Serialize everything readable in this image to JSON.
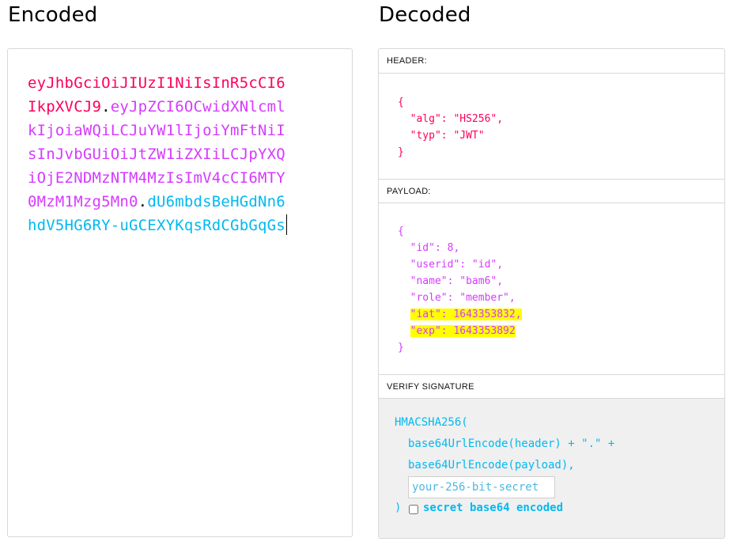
{
  "encoded": {
    "title": "Encoded",
    "token_lines": [
      [
        {
          "t": "eyJhbGciOiJIUzI1NiIsInR5cCI6",
          "c": "seg-header"
        }
      ],
      [
        {
          "t": "IkpXVCJ9",
          "c": "seg-header"
        },
        {
          "t": ".",
          "c": "dot"
        },
        {
          "t": "eyJpZCI6OCwidXNlcml",
          "c": "seg-payload"
        }
      ],
      [
        {
          "t": "kIjoiaWQiLCJuYW1lIjoiYmFtNiI",
          "c": "seg-payload"
        }
      ],
      [
        {
          "t": "sInJvbGUiOiJtZW1iZXIiLCJpYXQ",
          "c": "seg-payload"
        }
      ],
      [
        {
          "t": "iOjE2NDMzNTM4MzIsImV4cCI6MTY",
          "c": "seg-payload"
        }
      ],
      [
        {
          "t": "0MzM1Mzg5Mn0",
          "c": "seg-payload"
        },
        {
          "t": ".",
          "c": "dot"
        },
        {
          "t": "dU6mbdsBeHGdNn6",
          "c": "seg-sig"
        }
      ],
      [
        {
          "t": "hdV5HG6RY-uGCEXYKqsRdCGbGqGs",
          "c": "seg-sig"
        }
      ]
    ],
    "colors": {
      "header": "#fb015b",
      "payload": "#d63aff",
      "signature": "#00b9f1"
    }
  },
  "decoded": {
    "title": "Decoded",
    "header_label": "HEADER:",
    "header_lines": [
      "{",
      "  \"alg\": \"HS256\",",
      "  \"typ\": \"JWT\"",
      "}"
    ],
    "payload_label": "PAYLOAD:",
    "payload_lines": [
      {
        "text": "{",
        "highlight": false
      },
      {
        "text": "  \"id\": 8,",
        "highlight": false
      },
      {
        "text": "  \"userid\": \"id\",",
        "highlight": false
      },
      {
        "text": "  \"name\": \"bam6\",",
        "highlight": false
      },
      {
        "text": "  \"role\": \"member\",",
        "highlight": false
      },
      {
        "text": "  \"iat\": 1643353832,",
        "highlight": true
      },
      {
        "text": "  \"exp\": 1643353892",
        "highlight": true
      },
      {
        "text": "}",
        "highlight": false
      }
    ],
    "verify_label": "VERIFY SIGNATURE",
    "verify": {
      "line1": "HMACSHA256(",
      "line2": "base64UrlEncode(header) + \".\" +",
      "line3": "base64UrlEncode(payload),",
      "secret_value": "",
      "secret_placeholder": "your-256-bit-secret",
      "close": ")",
      "checkbox_label": "secret base64 encoded",
      "checkbox_checked": false
    },
    "highlight_color": "#ffff00"
  }
}
